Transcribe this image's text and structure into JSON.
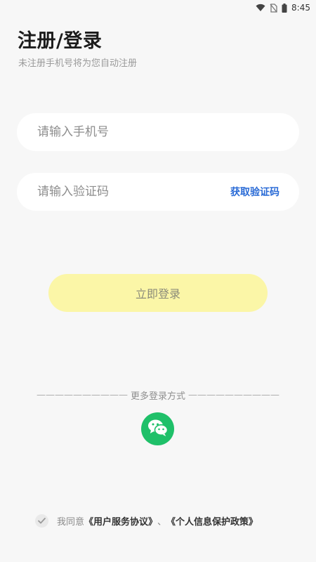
{
  "status_bar": {
    "time": "8:45"
  },
  "header": {
    "title": "注册/登录",
    "subtitle": "未注册手机号将为您自动注册"
  },
  "form": {
    "phone_placeholder": "请输入手机号",
    "phone_value": "",
    "code_placeholder": "请输入验证码",
    "code_value": "",
    "get_code_label": "获取验证码",
    "login_label": "立即登录"
  },
  "other_login": {
    "dash_left": "——————————",
    "label": "更多登录方式",
    "dash_right": "——————————",
    "icon": "wechat-icon"
  },
  "agreement": {
    "prefix": "我同意",
    "terms_link": "《用户服务协议》",
    "separator": "、",
    "privacy_link": "《个人信息保护政策》",
    "checked": false
  },
  "colors": {
    "background": "#f7f7f7",
    "button": "#fbf6a7",
    "link_blue": "#2a6bd6",
    "wechat_green": "#1fc069"
  }
}
